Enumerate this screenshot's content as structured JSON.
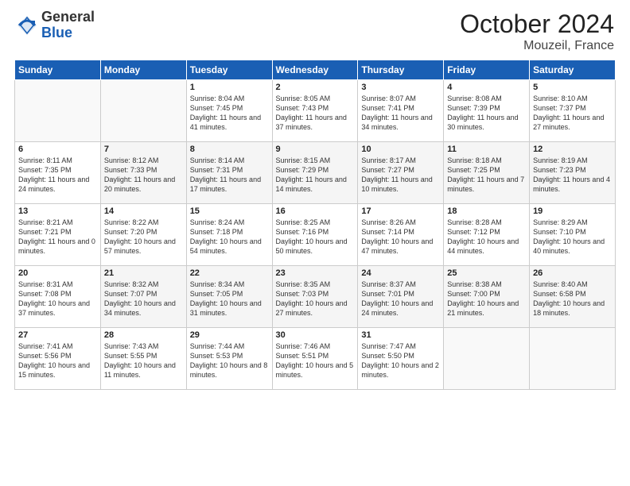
{
  "logo": {
    "general": "General",
    "blue": "Blue"
  },
  "header": {
    "month": "October 2024",
    "location": "Mouzeil, France"
  },
  "weekdays": [
    "Sunday",
    "Monday",
    "Tuesday",
    "Wednesday",
    "Thursday",
    "Friday",
    "Saturday"
  ],
  "weeks": [
    [
      {
        "day": "",
        "sunrise": "",
        "sunset": "",
        "daylight": ""
      },
      {
        "day": "",
        "sunrise": "",
        "sunset": "",
        "daylight": ""
      },
      {
        "day": "1",
        "sunrise": "Sunrise: 8:04 AM",
        "sunset": "Sunset: 7:45 PM",
        "daylight": "Daylight: 11 hours and 41 minutes."
      },
      {
        "day": "2",
        "sunrise": "Sunrise: 8:05 AM",
        "sunset": "Sunset: 7:43 PM",
        "daylight": "Daylight: 11 hours and 37 minutes."
      },
      {
        "day": "3",
        "sunrise": "Sunrise: 8:07 AM",
        "sunset": "Sunset: 7:41 PM",
        "daylight": "Daylight: 11 hours and 34 minutes."
      },
      {
        "day": "4",
        "sunrise": "Sunrise: 8:08 AM",
        "sunset": "Sunset: 7:39 PM",
        "daylight": "Daylight: 11 hours and 30 minutes."
      },
      {
        "day": "5",
        "sunrise": "Sunrise: 8:10 AM",
        "sunset": "Sunset: 7:37 PM",
        "daylight": "Daylight: 11 hours and 27 minutes."
      }
    ],
    [
      {
        "day": "6",
        "sunrise": "Sunrise: 8:11 AM",
        "sunset": "Sunset: 7:35 PM",
        "daylight": "Daylight: 11 hours and 24 minutes."
      },
      {
        "day": "7",
        "sunrise": "Sunrise: 8:12 AM",
        "sunset": "Sunset: 7:33 PM",
        "daylight": "Daylight: 11 hours and 20 minutes."
      },
      {
        "day": "8",
        "sunrise": "Sunrise: 8:14 AM",
        "sunset": "Sunset: 7:31 PM",
        "daylight": "Daylight: 11 hours and 17 minutes."
      },
      {
        "day": "9",
        "sunrise": "Sunrise: 8:15 AM",
        "sunset": "Sunset: 7:29 PM",
        "daylight": "Daylight: 11 hours and 14 minutes."
      },
      {
        "day": "10",
        "sunrise": "Sunrise: 8:17 AM",
        "sunset": "Sunset: 7:27 PM",
        "daylight": "Daylight: 11 hours and 10 minutes."
      },
      {
        "day": "11",
        "sunrise": "Sunrise: 8:18 AM",
        "sunset": "Sunset: 7:25 PM",
        "daylight": "Daylight: 11 hours and 7 minutes."
      },
      {
        "day": "12",
        "sunrise": "Sunrise: 8:19 AM",
        "sunset": "Sunset: 7:23 PM",
        "daylight": "Daylight: 11 hours and 4 minutes."
      }
    ],
    [
      {
        "day": "13",
        "sunrise": "Sunrise: 8:21 AM",
        "sunset": "Sunset: 7:21 PM",
        "daylight": "Daylight: 11 hours and 0 minutes."
      },
      {
        "day": "14",
        "sunrise": "Sunrise: 8:22 AM",
        "sunset": "Sunset: 7:20 PM",
        "daylight": "Daylight: 10 hours and 57 minutes."
      },
      {
        "day": "15",
        "sunrise": "Sunrise: 8:24 AM",
        "sunset": "Sunset: 7:18 PM",
        "daylight": "Daylight: 10 hours and 54 minutes."
      },
      {
        "day": "16",
        "sunrise": "Sunrise: 8:25 AM",
        "sunset": "Sunset: 7:16 PM",
        "daylight": "Daylight: 10 hours and 50 minutes."
      },
      {
        "day": "17",
        "sunrise": "Sunrise: 8:26 AM",
        "sunset": "Sunset: 7:14 PM",
        "daylight": "Daylight: 10 hours and 47 minutes."
      },
      {
        "day": "18",
        "sunrise": "Sunrise: 8:28 AM",
        "sunset": "Sunset: 7:12 PM",
        "daylight": "Daylight: 10 hours and 44 minutes."
      },
      {
        "day": "19",
        "sunrise": "Sunrise: 8:29 AM",
        "sunset": "Sunset: 7:10 PM",
        "daylight": "Daylight: 10 hours and 40 minutes."
      }
    ],
    [
      {
        "day": "20",
        "sunrise": "Sunrise: 8:31 AM",
        "sunset": "Sunset: 7:08 PM",
        "daylight": "Daylight: 10 hours and 37 minutes."
      },
      {
        "day": "21",
        "sunrise": "Sunrise: 8:32 AM",
        "sunset": "Sunset: 7:07 PM",
        "daylight": "Daylight: 10 hours and 34 minutes."
      },
      {
        "day": "22",
        "sunrise": "Sunrise: 8:34 AM",
        "sunset": "Sunset: 7:05 PM",
        "daylight": "Daylight: 10 hours and 31 minutes."
      },
      {
        "day": "23",
        "sunrise": "Sunrise: 8:35 AM",
        "sunset": "Sunset: 7:03 PM",
        "daylight": "Daylight: 10 hours and 27 minutes."
      },
      {
        "day": "24",
        "sunrise": "Sunrise: 8:37 AM",
        "sunset": "Sunset: 7:01 PM",
        "daylight": "Daylight: 10 hours and 24 minutes."
      },
      {
        "day": "25",
        "sunrise": "Sunrise: 8:38 AM",
        "sunset": "Sunset: 7:00 PM",
        "daylight": "Daylight: 10 hours and 21 minutes."
      },
      {
        "day": "26",
        "sunrise": "Sunrise: 8:40 AM",
        "sunset": "Sunset: 6:58 PM",
        "daylight": "Daylight: 10 hours and 18 minutes."
      }
    ],
    [
      {
        "day": "27",
        "sunrise": "Sunrise: 7:41 AM",
        "sunset": "Sunset: 5:56 PM",
        "daylight": "Daylight: 10 hours and 15 minutes."
      },
      {
        "day": "28",
        "sunrise": "Sunrise: 7:43 AM",
        "sunset": "Sunset: 5:55 PM",
        "daylight": "Daylight: 10 hours and 11 minutes."
      },
      {
        "day": "29",
        "sunrise": "Sunrise: 7:44 AM",
        "sunset": "Sunset: 5:53 PM",
        "daylight": "Daylight: 10 hours and 8 minutes."
      },
      {
        "day": "30",
        "sunrise": "Sunrise: 7:46 AM",
        "sunset": "Sunset: 5:51 PM",
        "daylight": "Daylight: 10 hours and 5 minutes."
      },
      {
        "day": "31",
        "sunrise": "Sunrise: 7:47 AM",
        "sunset": "Sunset: 5:50 PM",
        "daylight": "Daylight: 10 hours and 2 minutes."
      },
      {
        "day": "",
        "sunrise": "",
        "sunset": "",
        "daylight": ""
      },
      {
        "day": "",
        "sunrise": "",
        "sunset": "",
        "daylight": ""
      }
    ]
  ]
}
